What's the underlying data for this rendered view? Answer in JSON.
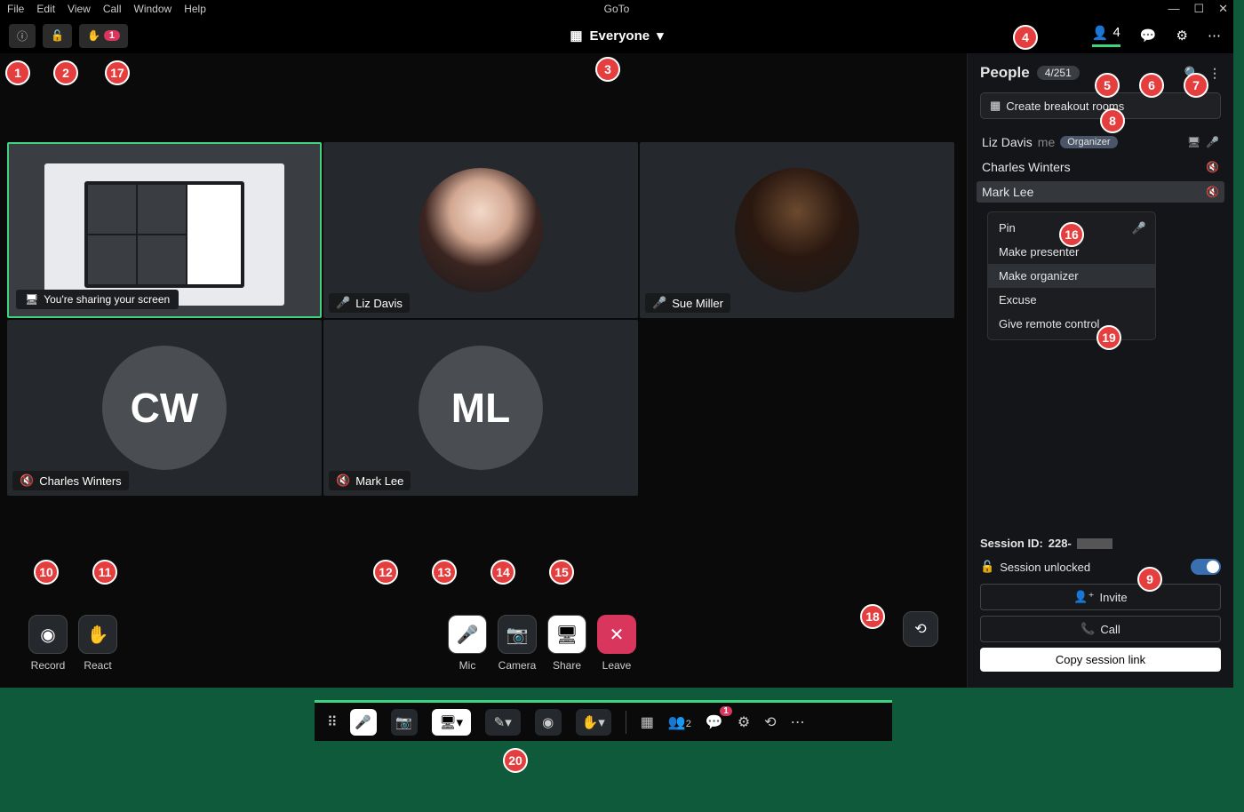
{
  "app_title": "GoTo",
  "menubar": [
    "File",
    "Edit",
    "View",
    "Call",
    "Window",
    "Help"
  ],
  "window_controls": [
    "—",
    "☐",
    "✕"
  ],
  "toolbar": {
    "hand_count": "1",
    "layout_label": "Everyone",
    "people_count": "4"
  },
  "tiles": {
    "share_banner": "You're sharing your screen",
    "t2_name": "Liz Davis",
    "t3_name": "Sue Miller",
    "t4_initials": "CW",
    "t4_name": "Charles Winters",
    "t5_initials": "ML",
    "t5_name": "Mark Lee"
  },
  "controls": {
    "record": "Record",
    "react": "React",
    "mic": "Mic",
    "camera": "Camera",
    "share": "Share",
    "leave": "Leave"
  },
  "sidebar": {
    "title": "People",
    "count": "4/251",
    "breakout": "Create breakout rooms",
    "p1_name": "Liz Davis",
    "p1_me": "me",
    "p1_role": "Organizer",
    "p2_name": "Charles Winters",
    "p3_name": "Mark Lee",
    "menu": {
      "pin": "Pin",
      "presenter": "Make presenter",
      "organizer": "Make organizer",
      "excuse": "Excuse",
      "remote": "Give remote control"
    },
    "session_id_label": "Session ID:",
    "session_id_value": "228-",
    "unlocked": "Session unlocked",
    "invite": "Invite",
    "call": "Call",
    "copy": "Copy session link"
  },
  "mini": {
    "people_count": "2",
    "chat_badge": "1"
  },
  "bubbles": {
    "1": "1",
    "2": "2",
    "3": "3",
    "4": "4",
    "5": "5",
    "6": "6",
    "7": "7",
    "8": "8",
    "9": "9",
    "10": "10",
    "11": "11",
    "12": "12",
    "13": "13",
    "14": "14",
    "15": "15",
    "16": "16",
    "17": "17",
    "18": "18",
    "19": "19",
    "20": "20"
  }
}
